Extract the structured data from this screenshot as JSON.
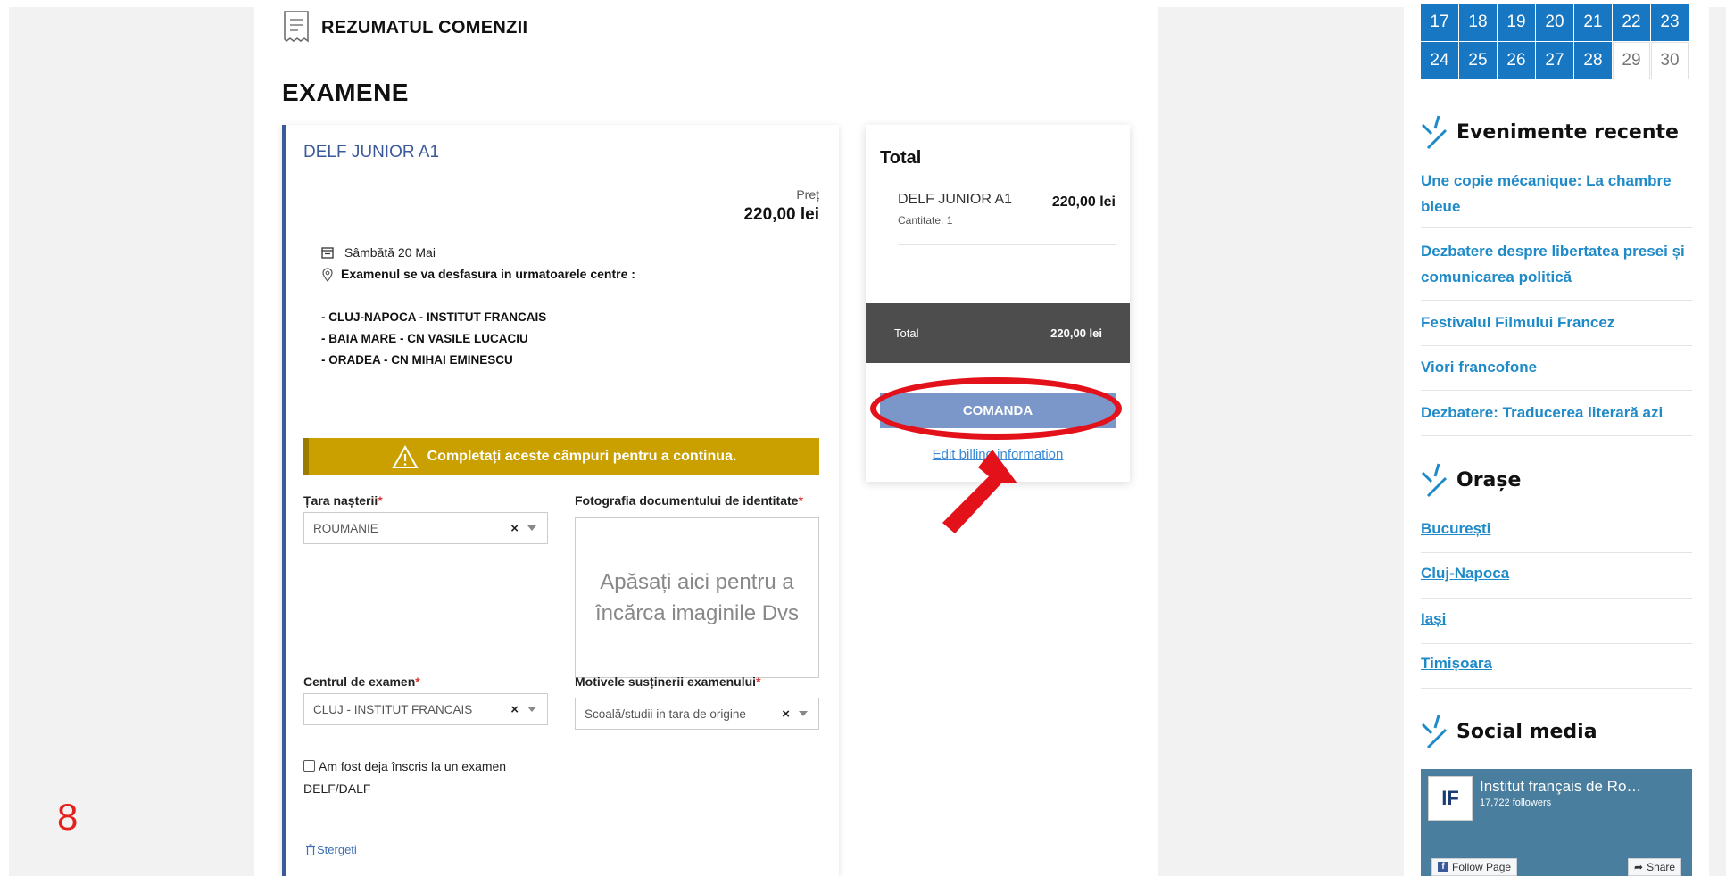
{
  "step_number": "8",
  "header": {
    "summary_title": "REZUMATUL COMENZII",
    "section_title": "EXAMENE"
  },
  "exam": {
    "name": "DELF JUNIOR A1",
    "price_label": "Preț",
    "price_value": "220,00 lei",
    "date": "Sâmbătă 20 Mai",
    "centers_intro": "Examenul se va desfasura in urmatoarele centre :",
    "centers": [
      "- CLUJ-NAPOCA - INSTITUT FRANCAIS",
      "- BAIA MARE - CN VASILE LUCACIU",
      "- ORADEA - CN MIHAI EMINESCU"
    ],
    "warning": "Completați aceste câmpuri pentru a continua.",
    "form": {
      "birth_country_label": "Țara nașterii",
      "birth_country_value": "ROUMANIE",
      "photo_label": "Fotografia documentului de identitate",
      "photo_placeholder": "Apăsați aici pentru a încărca imaginile Dvs",
      "center_label": "Centrul de examen",
      "center_value": "CLUJ - INSTITUT FRANCAIS",
      "reason_label": "Motivele susținerii examenului",
      "reason_value": "Scoală/studii in tara de origine",
      "checkbox_label_1": "Am fost deja înscris la un examen",
      "checkbox_label_2": "DELF/DALF",
      "required_mark": "*",
      "clear_symbol": "×",
      "delete_label": "Stergeți"
    }
  },
  "total": {
    "title": "Total",
    "item_name": "DELF JUNIOR A1",
    "item_qty": "Cantitate: 1",
    "item_price": "220,00 lei",
    "bar_label": "Total",
    "bar_value": "220,00 lei",
    "order_button": "COMANDA",
    "billing_link": "Edit billing information"
  },
  "sidebar": {
    "calendar_rows": [
      [
        {
          "d": "17",
          "active": true
        },
        {
          "d": "18",
          "active": true
        },
        {
          "d": "19",
          "active": true
        },
        {
          "d": "20",
          "active": true
        },
        {
          "d": "21",
          "active": true
        },
        {
          "d": "22",
          "active": true
        },
        {
          "d": "23",
          "active": true
        }
      ],
      [
        {
          "d": "24",
          "active": true
        },
        {
          "d": "25",
          "active": true
        },
        {
          "d": "26",
          "active": true
        },
        {
          "d": "27",
          "active": true
        },
        {
          "d": "28",
          "active": true
        },
        {
          "d": "29",
          "active": false
        },
        {
          "d": "30",
          "active": false
        }
      ]
    ],
    "recent_events_title": "Evenimente recente",
    "recent_events": [
      "Une copie mécanique: La chambre bleue",
      "Dezbatere despre libertatea presei și comunicarea politică",
      "Festivalul Filmului Francez",
      "Viori francofone",
      "Dezbatere: Traducerea literară azi"
    ],
    "cities_title": "Orașe",
    "cities": [
      "București",
      "Cluj-Napoca",
      "Iași",
      "Timișoara"
    ],
    "social_title": "Social media",
    "facebook": {
      "logo": "IF",
      "page_name": "Institut français de Ro…",
      "followers": "17,722 followers",
      "follow_label": "Follow Page",
      "share_label": "Share"
    }
  },
  "colors": {
    "accent_blue": "#1877c2",
    "link_blue": "#1f8ac8",
    "warning_gold": "#c9a000",
    "order_button": "#7b96c8",
    "annotation_red": "#e3121a"
  }
}
